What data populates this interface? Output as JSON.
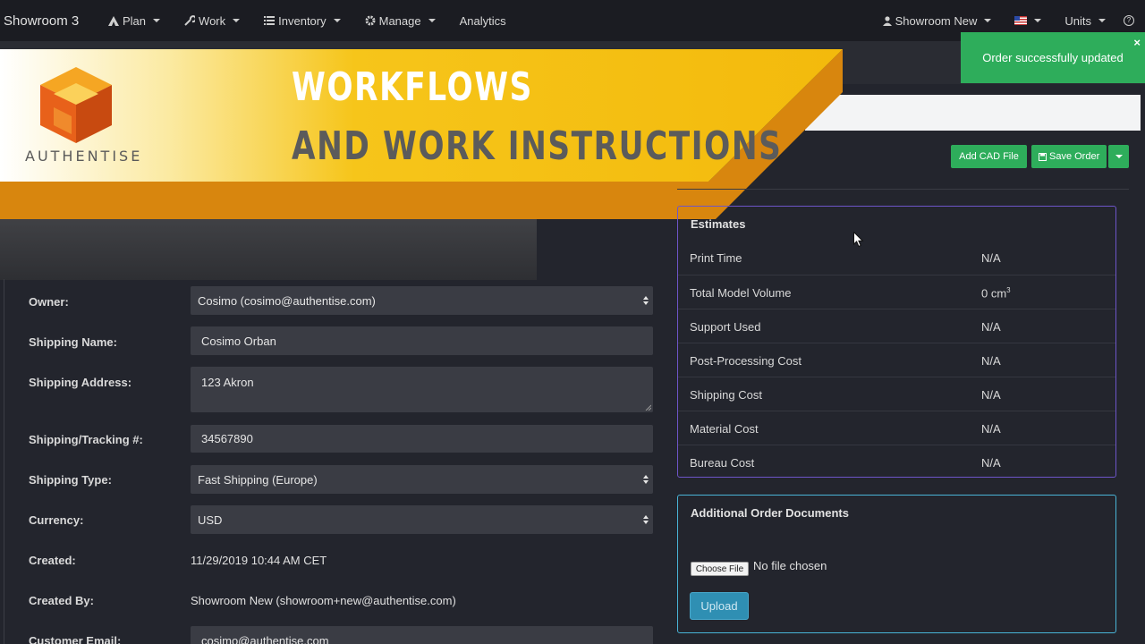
{
  "navbar": {
    "brand": "Showroom 3",
    "items": [
      {
        "label": "Plan",
        "icon": "plan-icon"
      },
      {
        "label": "Work",
        "icon": "wrench-icon"
      },
      {
        "label": "Inventory",
        "icon": "list-icon"
      },
      {
        "label": "Manage",
        "icon": "gear-icon"
      },
      {
        "label": "Analytics"
      }
    ],
    "user": "Showroom New",
    "units": "Units"
  },
  "banner": {
    "logo_text": "AUTHENTISE",
    "title_line1": "WORKFLOWS",
    "title_line2": "AND WORK INSTRUCTIONS"
  },
  "toast": {
    "message": "Order successfully updated",
    "close": "×"
  },
  "actions": {
    "add_cad": "Add CAD File",
    "save_order": "Save Order"
  },
  "form": {
    "owner_label": "Owner:",
    "owner_value": "Cosimo (cosimo@authentise.com)",
    "shipping_name_label": "Shipping Name:",
    "shipping_name_value": "Cosimo Orban",
    "shipping_address_label": "Shipping Address:",
    "shipping_address_value": "123 Akron",
    "tracking_label": "Shipping/Tracking #:",
    "tracking_value": "34567890",
    "shipping_type_label": "Shipping Type:",
    "shipping_type_value": "Fast Shipping (Europe)",
    "currency_label": "Currency:",
    "currency_value": "USD",
    "created_label": "Created:",
    "created_value": "11/29/2019 10:44 AM CET",
    "created_by_label": "Created By:",
    "created_by_value": "Showroom New (showroom+new@authentise.com)",
    "customer_email_label": "Customer Email:",
    "customer_email_value": "cosimo@authentise.com"
  },
  "estimates": {
    "title": "Estimates",
    "rows": [
      {
        "label": "Print Time",
        "value": "N/A"
      },
      {
        "label": "Total Model Volume",
        "value": "0 cm",
        "sup": "3"
      },
      {
        "label": "Support Used",
        "value": "N/A"
      },
      {
        "label": "Post-Processing Cost",
        "value": "N/A"
      },
      {
        "label": "Shipping Cost",
        "value": "N/A"
      },
      {
        "label": "Material Cost",
        "value": "N/A"
      },
      {
        "label": "Bureau Cost",
        "value": "N/A"
      }
    ]
  },
  "documents": {
    "title": "Additional Order Documents",
    "choose_file": "Choose File",
    "no_file": "No file chosen",
    "upload": "Upload"
  },
  "colors": {
    "success": "#2ead5b",
    "estimates_border": "#6d55c8",
    "documents_border": "#49b4d6",
    "upload": "#2f8fb3"
  }
}
